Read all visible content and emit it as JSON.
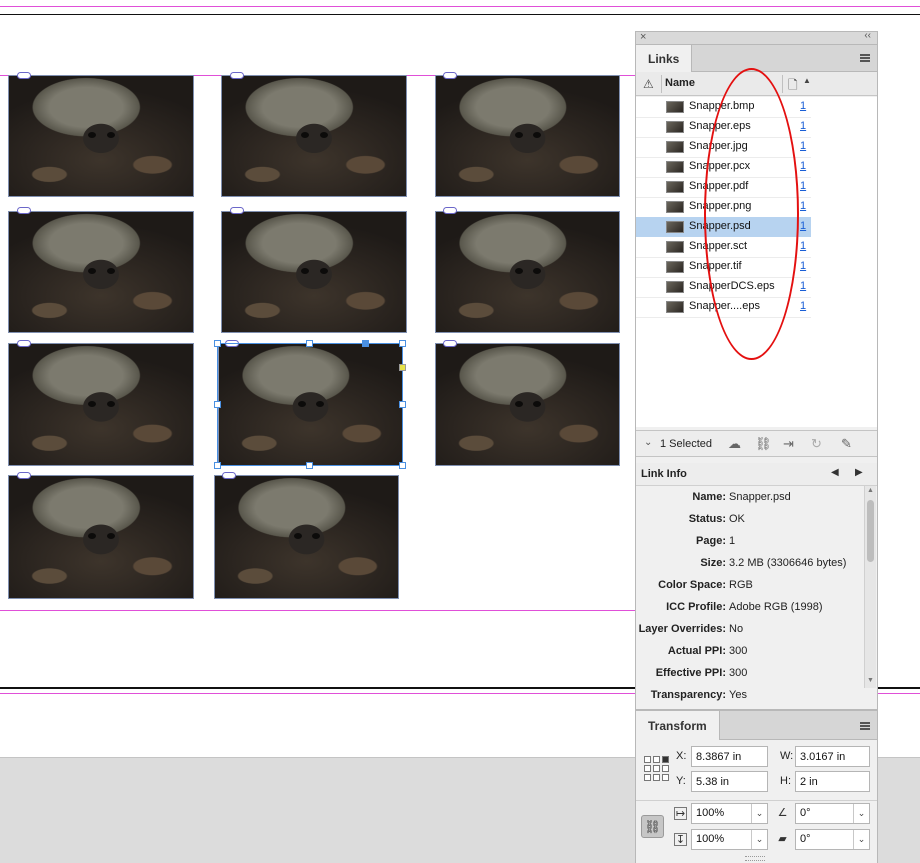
{
  "app": {
    "links_panel": {
      "tab_label": "Links",
      "column_headers": {
        "name": "Name"
      },
      "links": [
        {
          "name": "Snapper.bmp",
          "page": "1"
        },
        {
          "name": "Snapper.eps",
          "page": "1"
        },
        {
          "name": "Snapper.jpg",
          "page": "1"
        },
        {
          "name": "Snapper.pcx",
          "page": "1"
        },
        {
          "name": "Snapper.pdf",
          "page": "1"
        },
        {
          "name": "Snapper.png",
          "page": "1"
        },
        {
          "name": "Snapper.psd",
          "page": "1",
          "selected": true
        },
        {
          "name": "Snapper.sct",
          "page": "1"
        },
        {
          "name": "Snapper.tif",
          "page": "1"
        },
        {
          "name": "SnapperDCS.eps",
          "page": "1"
        },
        {
          "name": "Snapper....eps",
          "page": "1"
        }
      ],
      "selection_count": "1 Selected",
      "toolbar_icons": [
        "cloud-link-icon",
        "relink-icon",
        "go-to-link-icon",
        "update-link-icon",
        "edit-original-icon"
      ]
    },
    "link_info": {
      "title": "Link Info",
      "fields": [
        {
          "label": "Name:",
          "value": "Snapper.psd"
        },
        {
          "label": "Status:",
          "value": "OK"
        },
        {
          "label": "Page:",
          "value": "1"
        },
        {
          "label": "Size:",
          "value": "3.2 MB (3306646 bytes)"
        },
        {
          "label": "Color Space:",
          "value": "RGB"
        },
        {
          "label": "ICC Profile:",
          "value": "Adobe RGB (1998)"
        },
        {
          "label": "Layer Overrides:",
          "value": "No"
        },
        {
          "label": "Actual PPI:",
          "value": "300"
        },
        {
          "label": "Effective PPI:",
          "value": "300"
        },
        {
          "label": "Transparency:",
          "value": "Yes"
        }
      ]
    },
    "transform_panel": {
      "tab_label": "Transform",
      "x_label": "X:",
      "x_value": "8.3867 in",
      "y_label": "Y:",
      "y_value": "5.38 in",
      "w_label": "W:",
      "w_value": "3.0167 in",
      "h_label": "H:",
      "h_value": "2 in",
      "scale_x": "100%",
      "scale_y": "100%",
      "rotation": "0°",
      "shear": "0°"
    },
    "colors": {
      "selection_row": "#b7d3f0",
      "annotation_ellipse": "#e41010",
      "margin_guide": "#e04fd8",
      "link_page_number": "#1a5fd6"
    }
  }
}
